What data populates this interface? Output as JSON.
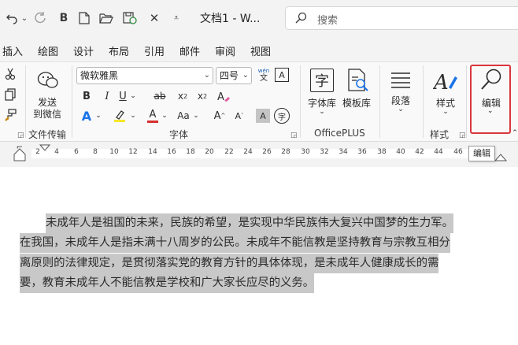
{
  "window": {
    "title": "文档1 - W...",
    "search_placeholder": "搜索"
  },
  "menu": {
    "tabs": [
      "插入",
      "绘图",
      "设计",
      "布局",
      "引用",
      "邮件",
      "审阅",
      "视图"
    ]
  },
  "ribbon": {
    "file_transfer": {
      "button_label_line1": "发送",
      "button_label_line2": "到微信",
      "group_label": "文件传输"
    },
    "font": {
      "font_name": "微软雅黑",
      "font_size": "四号",
      "phonetic_glyph": "wén",
      "group_label": "字体"
    },
    "officeplus": {
      "font_library_label": "字体库",
      "template_library_label": "模板库",
      "group_label": "OfficePLUS"
    },
    "paragraph": {
      "label": "段落"
    },
    "styles": {
      "label": "样式",
      "group_label": "样式"
    },
    "editing": {
      "label": "编辑"
    }
  },
  "ruler": {
    "numbers": [
      "2",
      "4",
      "6",
      "8",
      "10",
      "12",
      "14",
      "16",
      "18",
      "20",
      "22",
      "24",
      "26",
      "28",
      "30",
      "32",
      "34",
      "36",
      "38",
      "40",
      "42",
      "44",
      "46"
    ]
  },
  "tooltip": {
    "text": "编辑"
  },
  "document": {
    "lines": [
      "未成年人是祖国的未来，民族的希望，是实现中华民族伟大复兴中国梦的生力军。",
      "在我国，未成年人是指未满十八周岁的公民。未成年不能信教是坚持教育与宗教互相分",
      "离原则的法律规定，是贯彻落实党的教育方针的具体体现，是未成年人健康成长的需",
      "要，教育未成年人不能信教是学校和广大家长应尽的义务。"
    ]
  }
}
